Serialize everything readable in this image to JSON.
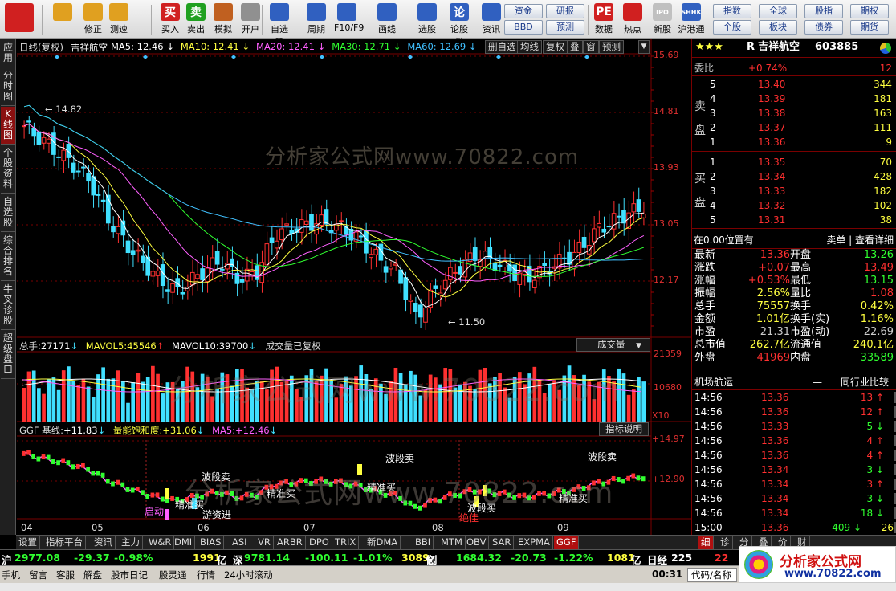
{
  "toolbar": {
    "left": [
      {
        "label": "",
        "icon": "app-menu-icon",
        "color": "#d02020"
      },
      {
        "label": "",
        "icon": "back-arrow-icon",
        "color": "#e0a020"
      },
      {
        "label": "修正",
        "icon": "up-down-arrow-icon",
        "color": "#e0a020"
      },
      {
        "label": "测速",
        "icon": "clock-icon",
        "color": "#e0a020"
      },
      {
        "label": "买入",
        "icon": "buy-icon",
        "color": "#d02020",
        "glyph": "买"
      },
      {
        "label": "卖出",
        "icon": "sell-icon",
        "color": "#20a020",
        "glyph": "卖"
      },
      {
        "label": "模拟",
        "icon": "hammer-icon",
        "color": "#c06020"
      },
      {
        "label": "开户",
        "icon": "lock-icon",
        "color": "#909090"
      },
      {
        "label": "自选股",
        "icon": "star-icon",
        "color": "#3060c0"
      },
      {
        "label": "周期",
        "icon": "period-icon",
        "color": "#3060c0"
      },
      {
        "label": "F10/F9",
        "icon": "f10-icon",
        "color": "#3060c0"
      },
      {
        "label": "画线",
        "icon": "pen-icon",
        "color": "#3060c0"
      },
      {
        "label": "选股",
        "icon": "select-stock-icon",
        "color": "#3060c0"
      },
      {
        "label": "论股堂",
        "icon": "forum-icon",
        "color": "#3060c0",
        "glyph": "论"
      },
      {
        "label": "资讯",
        "icon": "news-icon",
        "color": "#3060c0"
      },
      {
        "label": "数据",
        "icon": "pe-icon",
        "color": "#d02020",
        "glyph": "PE"
      },
      {
        "label": "热点",
        "icon": "hot-icon",
        "color": "#d02020"
      },
      {
        "label": "新股",
        "icon": "ipo-icon",
        "color": "#c0c0c0",
        "glyph": "IPO"
      },
      {
        "label": "沪港通",
        "icon": "sh-hk-icon",
        "color": "#3060c0",
        "glyph": "SHHK"
      }
    ],
    "mid_buttons": [
      "资金",
      "研报",
      "BBD",
      "预测"
    ],
    "right_buttons": [
      "指数",
      "全球",
      "股指",
      "期权",
      "个股",
      "板块",
      "债券",
      "期货"
    ]
  },
  "left_tabs": [
    "应用",
    "分时图",
    "K线图",
    "个股资料",
    "自选股",
    "综合排名",
    "牛叉诊股",
    "超级盘口"
  ],
  "chart": {
    "title": "日线(复权)",
    "stock_name": "吉祥航空",
    "ma": [
      {
        "label": "MA5:",
        "value": "12.46",
        "color": "#ffffff"
      },
      {
        "label": "MA10:",
        "value": "12.41",
        "color": "#ffff40"
      },
      {
        "label": "MA20:",
        "value": "12.41",
        "color": "#ff60ff"
      },
      {
        "label": "MA30:",
        "value": "12.71",
        "color": "#30ff30"
      },
      {
        "label": "MA60:",
        "value": "12.69",
        "color": "#40c0ff"
      }
    ],
    "header_buttons": [
      "删自选",
      "均线",
      "复权",
      "叠",
      "窗",
      "预测"
    ],
    "price_axis": [
      "15.69",
      "14.81",
      "13.93",
      "13.05",
      "12.17"
    ],
    "high_label": "14.82",
    "low_label": "11.50",
    "volume": {
      "label": "总手:",
      "value": "27171",
      "mavol5_label": "MAVOL5:",
      "mavol5": "45546",
      "mavol10_label": "MAVOL10:",
      "mavol10": "39700",
      "note": "成交量已复权",
      "selector": "成交量",
      "axis": [
        "21359",
        "10680"
      ],
      "unit": "X10"
    },
    "ggf": {
      "label": "GGF 基线:",
      "value": "+11.83",
      "energy_label": "量能饱和度:",
      "energy": "+31.06",
      "ma5_label": "MA5:",
      "ma5": "+12.46",
      "button": "指标说明",
      "axis": [
        "+14.97",
        "+12.90"
      ],
      "annotations": [
        "波段卖",
        "波段卖",
        "波段卖",
        "精准买",
        "精准买",
        "精准买",
        "精准买",
        "游资进",
        "波段买",
        "启动",
        "绝佳"
      ]
    },
    "months": [
      "04",
      "05",
      "06",
      "07",
      "08",
      "09"
    ]
  },
  "watermark": "分析家公式网www.70822.com",
  "quote": {
    "stars": "★★★",
    "code_prefix": "R",
    "name": "吉祥航空",
    "code": "603885",
    "weibi_label": "委比",
    "weibi": "+0.74%",
    "weicha": "12",
    "sell_label": "卖盘",
    "buy_label": "买盘",
    "sell": [
      {
        "n": "5",
        "price": "13.40",
        "vol": "344"
      },
      {
        "n": "4",
        "price": "13.39",
        "vol": "181"
      },
      {
        "n": "3",
        "price": "13.38",
        "vol": "163"
      },
      {
        "n": "2",
        "price": "13.37",
        "vol": "111"
      },
      {
        "n": "1",
        "price": "13.36",
        "vol": "9"
      }
    ],
    "buy": [
      {
        "n": "1",
        "price": "13.35",
        "vol": "70"
      },
      {
        "n": "2",
        "price": "13.34",
        "vol": "428"
      },
      {
        "n": "3",
        "price": "13.33",
        "vol": "182"
      },
      {
        "n": "4",
        "price": "13.32",
        "vol": "102"
      },
      {
        "n": "5",
        "price": "13.31",
        "vol": "38"
      }
    ],
    "position_text": "在0.00位置有",
    "detail_link": "卖单 | 查看详细",
    "stats": [
      {
        "l": "最新",
        "v": "13.36",
        "vc": "red",
        "l2": "开盘",
        "v2": "13.26",
        "v2c": "green"
      },
      {
        "l": "涨跌",
        "v": "+0.07",
        "vc": "red",
        "l2": "最高",
        "v2": "13.49",
        "v2c": "red"
      },
      {
        "l": "涨幅",
        "v": "+0.53%",
        "vc": "red",
        "l2": "最低",
        "v2": "13.15",
        "v2c": "green"
      },
      {
        "l": "振幅",
        "v": "2.56%",
        "vc": "yel",
        "l2": "量比",
        "v2": "1.08",
        "v2c": "red"
      },
      {
        "l": "总手",
        "v": "75557",
        "vc": "yel",
        "l2": "换手",
        "v2": "0.42%",
        "v2c": "yel"
      },
      {
        "l": "金额",
        "v": "1.01亿",
        "vc": "yel",
        "l2": "换手(实)",
        "v2": "1.16%",
        "v2c": "yel"
      },
      {
        "l": "市盈",
        "v": "21.31",
        "vc": "gry",
        "l2": "市盈(动)",
        "v2": "22.69",
        "v2c": "gry"
      },
      {
        "l": "总市值",
        "v": "262.7亿",
        "vc": "yel",
        "l2": "流通值",
        "v2": "240.1亿",
        "v2c": "yel"
      },
      {
        "l": "外盘",
        "v": "41969",
        "vc": "red",
        "l2": "内盘",
        "v2": "33589",
        "v2c": "green"
      }
    ],
    "industry": "机场航运",
    "industry_btn": "同行业比较",
    "ticks": [
      {
        "t": "14:56",
        "p": "13.36",
        "pc": "red",
        "v": "13",
        "d": "up"
      },
      {
        "t": "14:56",
        "p": "13.36",
        "pc": "red",
        "v": "12",
        "d": "up"
      },
      {
        "t": "14:56",
        "p": "13.33",
        "pc": "red",
        "v": "5",
        "d": "down"
      },
      {
        "t": "14:56",
        "p": "13.36",
        "pc": "red",
        "v": "4",
        "d": "up"
      },
      {
        "t": "14:56",
        "p": "13.36",
        "pc": "red",
        "v": "4",
        "d": "up"
      },
      {
        "t": "14:56",
        "p": "13.34",
        "pc": "red",
        "v": "3",
        "d": "down"
      },
      {
        "t": "14:56",
        "p": "13.34",
        "pc": "red",
        "v": "3",
        "d": "up"
      },
      {
        "t": "14:56",
        "p": "13.34",
        "pc": "red",
        "v": "3",
        "d": "down"
      },
      {
        "t": "14:56",
        "p": "13.34",
        "pc": "red",
        "v": "18",
        "d": "down"
      },
      {
        "t": "15:00",
        "p": "13.36",
        "pc": "red",
        "v": "409",
        "d": "down",
        "extra": "26"
      }
    ],
    "bottom_tabs": [
      "细",
      "诊",
      "分",
      "叠",
      "价",
      "财"
    ]
  },
  "bottom_tabs": [
    "设置",
    "指标平台",
    "资讯",
    "主力",
    "W&R",
    "DMI",
    "BIAS",
    "ASI",
    "VR",
    "ARBR",
    "DPO",
    "TRIX",
    "新DMA",
    "BBI",
    "MTM",
    "OBV",
    "SAR",
    "EXPMA",
    "GGF"
  ],
  "status": {
    "sh_label": "沪",
    "sh": "2977.08",
    "sh_chg": "-29.37",
    "sh_pct": "-0.98%",
    "sh_amt": "1991",
    "amt_unit": "亿",
    "sz_label": "深",
    "sz": "9781.14",
    "sz_chg": "-100.11",
    "sz_pct": "-1.01%",
    "sz_amt": "3089",
    "cy_label": "创",
    "cy": "1684.32",
    "cy_chg": "-20.73",
    "cy_pct": "-1.22%",
    "cy_amt": "1081",
    "rj_label": "日经",
    "rj": "225",
    "extra": "22"
  },
  "bottombar": {
    "items": [
      "手机",
      "留言",
      "客服",
      "解盘",
      "股市日记",
      "股灵通",
      "行情",
      "24小时滚动"
    ],
    "time": "00:31",
    "code_label": "代码/名称"
  },
  "logo": {
    "name": "分析家公式网",
    "url": "www.70822.com"
  }
}
